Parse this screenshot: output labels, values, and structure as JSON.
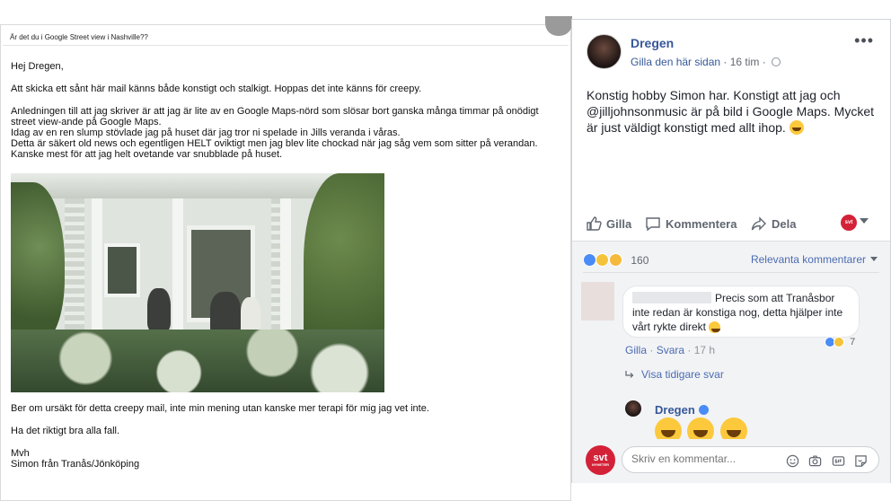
{
  "email": {
    "subject": "Är det du i Google Street view i Nashville??",
    "greeting": "Hej Dregen,",
    "line1": "Att skicka ett sånt här mail känns både konstigt och stalkigt. Hoppas det inte känns för creepy.",
    "para2": [
      "Anledningen till att jag skriver är att jag är lite av en Google Maps-nörd som slösar bort ganska många timmar på onödigt",
      "street view-ande på Google Maps.",
      "Idag av en ren slump stövlade jag på huset där jag tror ni spelade in Jills veranda i våras.",
      "Detta är säkert old news och egentligen HELT oviktigt men jag blev lite chockad när jag såg vem som sitter på verandan.",
      "Kanske mest för att jag helt ovetande var snubblade på huset."
    ],
    "apology": "Ber om ursäkt för detta creepy mail, inte min mening utan kanske mer terapi för mig jag vet inte.",
    "wish": "Ha det riktigt bra alla fall.",
    "signoff": "Mvh",
    "signature": "Simon från Tranås/Jönköping"
  },
  "post": {
    "author": "Dregen",
    "like_page": "Gilla den här sidan",
    "dot": "·",
    "time": "16 tim",
    "more": "•••",
    "text": "Konstig hobby Simon har. Konstigt att jag och @jilljohnsonmusic är på bild i Google Maps. Mycket är just väldigt konstigt med allt ihop.",
    "actions": {
      "like": "Gilla",
      "comment": "Kommentera",
      "share": "Dela",
      "svt_badge": "svt"
    },
    "reactions_count": "160",
    "sort_label": "Relevanta kommentarer",
    "comment": {
      "text": "Precis som att Tranåsbor inte redan är konstiga nog, detta hjälper inte vårt rykte direkt",
      "react_count": "7",
      "like": "Gilla",
      "reply": "Svara",
      "dot": "·",
      "time": "17 h"
    },
    "show_previous": "Visa tidigare svar",
    "reply": {
      "author": "Dregen"
    },
    "write": {
      "placeholder": "Skriv en kommentar...",
      "logo": "svt",
      "logo_sub": "NYHETER"
    }
  },
  "colors": {
    "fb_blue": "#365899",
    "link_blue": "#4b6bb2",
    "svt_red": "#d32238"
  }
}
